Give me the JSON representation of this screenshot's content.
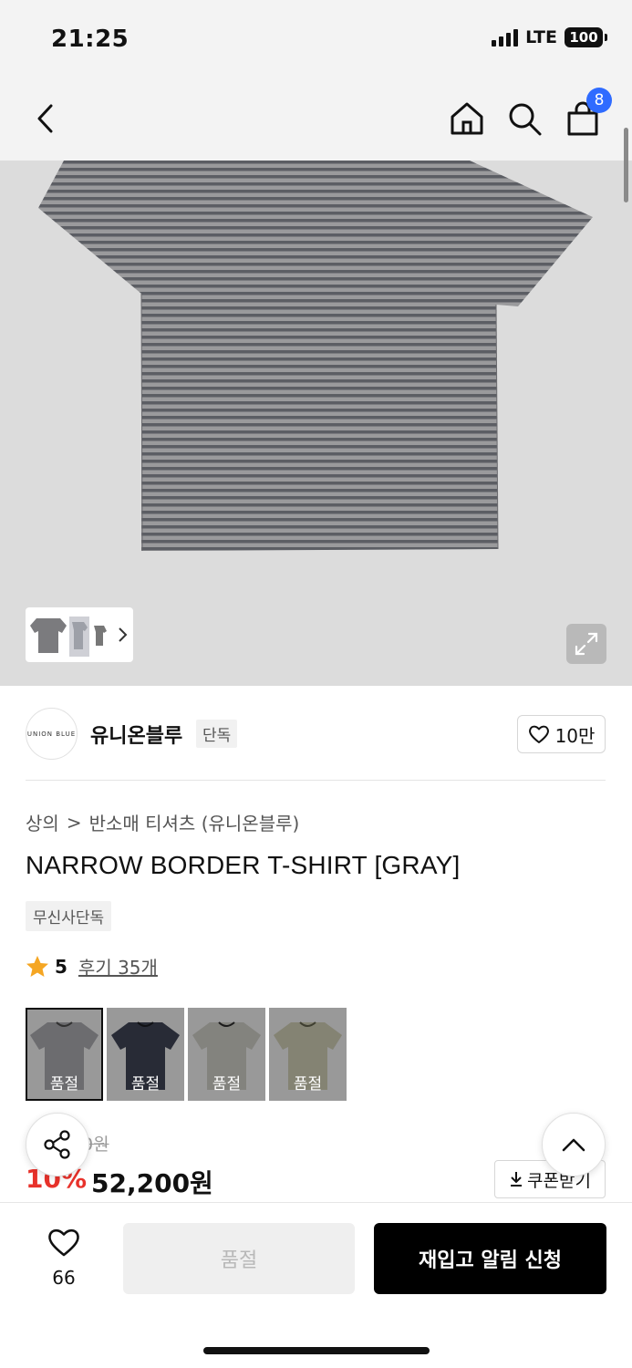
{
  "status_bar": {
    "time": "21:25",
    "network": "LTE",
    "battery": "100"
  },
  "header": {
    "cart_count": "8"
  },
  "brand": {
    "logo_text": "UNION BLUE",
    "name": "유니온블루",
    "tag": "단독",
    "likes": "10만"
  },
  "breadcrumb": {
    "level1": "상의",
    "separator": ">",
    "level2": "반소매 티셔츠 (유니온블루)"
  },
  "product": {
    "title": "NARROW BORDER T-SHIRT [GRAY]",
    "badge": "무신사단독",
    "rating": "5",
    "reviews": "후기 35개",
    "original_price": "0원",
    "discount": "10%",
    "price": "52,200원",
    "coupon_label": "쿠폰받기"
  },
  "swatches": [
    {
      "label": "품절",
      "color": "#8c8c8c",
      "selected": true
    },
    {
      "label": "품절",
      "color": "#2f3340",
      "selected": false
    },
    {
      "label": "품절",
      "color": "#9b9a94",
      "selected": false
    },
    {
      "label": "품절",
      "color": "#9c9a88",
      "selected": false
    }
  ],
  "bottom_bar": {
    "wish_count": "66",
    "soldout_label": "품절",
    "restock_label": "재입고 알림 신청"
  }
}
